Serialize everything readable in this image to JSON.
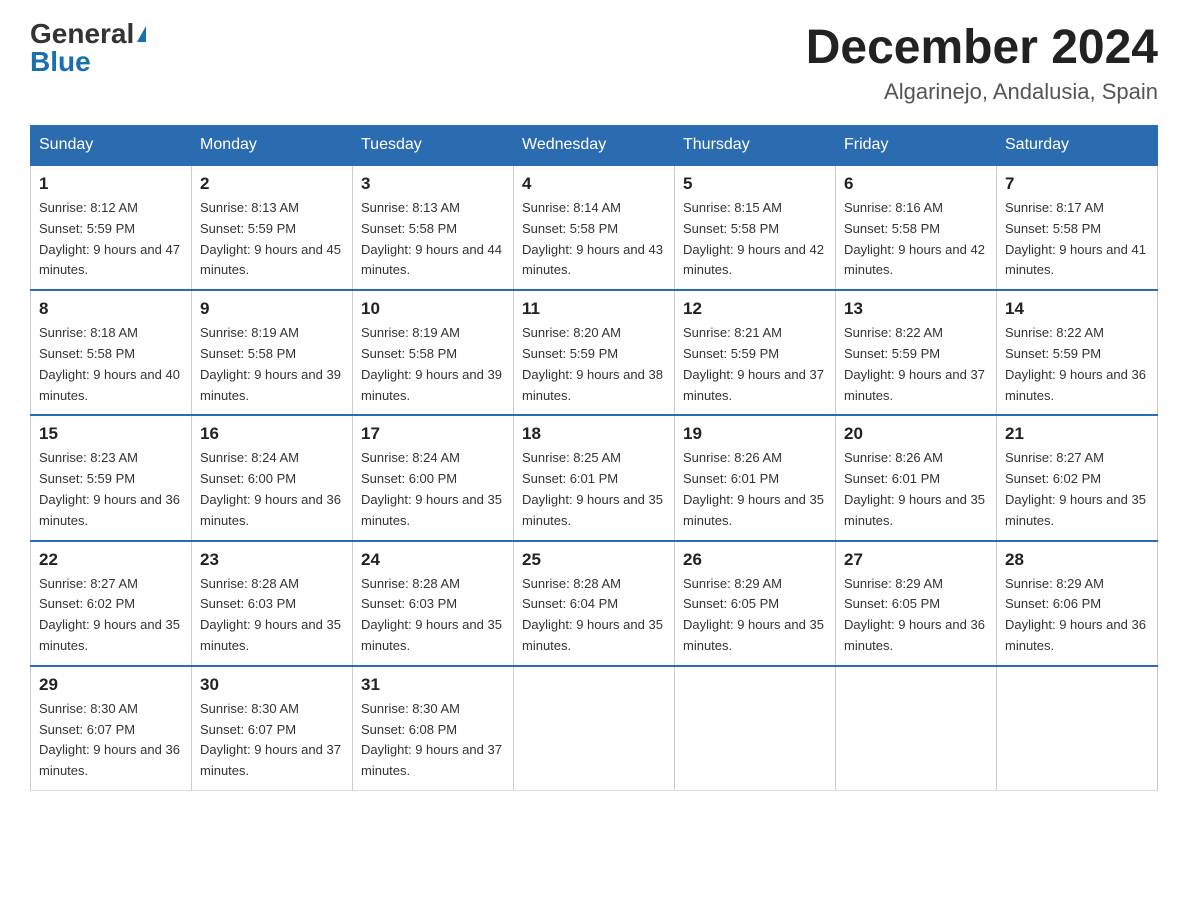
{
  "logo": {
    "general": "General",
    "blue": "Blue",
    "triangle": "▶"
  },
  "title": "December 2024",
  "subtitle": "Algarinejo, Andalusia, Spain",
  "days_of_week": [
    "Sunday",
    "Monday",
    "Tuesday",
    "Wednesday",
    "Thursday",
    "Friday",
    "Saturday"
  ],
  "weeks": [
    [
      {
        "day": "1",
        "sunrise": "8:12 AM",
        "sunset": "5:59 PM",
        "daylight": "9 hours and 47 minutes."
      },
      {
        "day": "2",
        "sunrise": "8:13 AM",
        "sunset": "5:59 PM",
        "daylight": "9 hours and 45 minutes."
      },
      {
        "day": "3",
        "sunrise": "8:13 AM",
        "sunset": "5:58 PM",
        "daylight": "9 hours and 44 minutes."
      },
      {
        "day": "4",
        "sunrise": "8:14 AM",
        "sunset": "5:58 PM",
        "daylight": "9 hours and 43 minutes."
      },
      {
        "day": "5",
        "sunrise": "8:15 AM",
        "sunset": "5:58 PM",
        "daylight": "9 hours and 42 minutes."
      },
      {
        "day": "6",
        "sunrise": "8:16 AM",
        "sunset": "5:58 PM",
        "daylight": "9 hours and 42 minutes."
      },
      {
        "day": "7",
        "sunrise": "8:17 AM",
        "sunset": "5:58 PM",
        "daylight": "9 hours and 41 minutes."
      }
    ],
    [
      {
        "day": "8",
        "sunrise": "8:18 AM",
        "sunset": "5:58 PM",
        "daylight": "9 hours and 40 minutes."
      },
      {
        "day": "9",
        "sunrise": "8:19 AM",
        "sunset": "5:58 PM",
        "daylight": "9 hours and 39 minutes."
      },
      {
        "day": "10",
        "sunrise": "8:19 AM",
        "sunset": "5:58 PM",
        "daylight": "9 hours and 39 minutes."
      },
      {
        "day": "11",
        "sunrise": "8:20 AM",
        "sunset": "5:59 PM",
        "daylight": "9 hours and 38 minutes."
      },
      {
        "day": "12",
        "sunrise": "8:21 AM",
        "sunset": "5:59 PM",
        "daylight": "9 hours and 37 minutes."
      },
      {
        "day": "13",
        "sunrise": "8:22 AM",
        "sunset": "5:59 PM",
        "daylight": "9 hours and 37 minutes."
      },
      {
        "day": "14",
        "sunrise": "8:22 AM",
        "sunset": "5:59 PM",
        "daylight": "9 hours and 36 minutes."
      }
    ],
    [
      {
        "day": "15",
        "sunrise": "8:23 AM",
        "sunset": "5:59 PM",
        "daylight": "9 hours and 36 minutes."
      },
      {
        "day": "16",
        "sunrise": "8:24 AM",
        "sunset": "6:00 PM",
        "daylight": "9 hours and 36 minutes."
      },
      {
        "day": "17",
        "sunrise": "8:24 AM",
        "sunset": "6:00 PM",
        "daylight": "9 hours and 35 minutes."
      },
      {
        "day": "18",
        "sunrise": "8:25 AM",
        "sunset": "6:01 PM",
        "daylight": "9 hours and 35 minutes."
      },
      {
        "day": "19",
        "sunrise": "8:26 AM",
        "sunset": "6:01 PM",
        "daylight": "9 hours and 35 minutes."
      },
      {
        "day": "20",
        "sunrise": "8:26 AM",
        "sunset": "6:01 PM",
        "daylight": "9 hours and 35 minutes."
      },
      {
        "day": "21",
        "sunrise": "8:27 AM",
        "sunset": "6:02 PM",
        "daylight": "9 hours and 35 minutes."
      }
    ],
    [
      {
        "day": "22",
        "sunrise": "8:27 AM",
        "sunset": "6:02 PM",
        "daylight": "9 hours and 35 minutes."
      },
      {
        "day": "23",
        "sunrise": "8:28 AM",
        "sunset": "6:03 PM",
        "daylight": "9 hours and 35 minutes."
      },
      {
        "day": "24",
        "sunrise": "8:28 AM",
        "sunset": "6:03 PM",
        "daylight": "9 hours and 35 minutes."
      },
      {
        "day": "25",
        "sunrise": "8:28 AM",
        "sunset": "6:04 PM",
        "daylight": "9 hours and 35 minutes."
      },
      {
        "day": "26",
        "sunrise": "8:29 AM",
        "sunset": "6:05 PM",
        "daylight": "9 hours and 35 minutes."
      },
      {
        "day": "27",
        "sunrise": "8:29 AM",
        "sunset": "6:05 PM",
        "daylight": "9 hours and 36 minutes."
      },
      {
        "day": "28",
        "sunrise": "8:29 AM",
        "sunset": "6:06 PM",
        "daylight": "9 hours and 36 minutes."
      }
    ],
    [
      {
        "day": "29",
        "sunrise": "8:30 AM",
        "sunset": "6:07 PM",
        "daylight": "9 hours and 36 minutes."
      },
      {
        "day": "30",
        "sunrise": "8:30 AM",
        "sunset": "6:07 PM",
        "daylight": "9 hours and 37 minutes."
      },
      {
        "day": "31",
        "sunrise": "8:30 AM",
        "sunset": "6:08 PM",
        "daylight": "9 hours and 37 minutes."
      },
      null,
      null,
      null,
      null
    ]
  ]
}
